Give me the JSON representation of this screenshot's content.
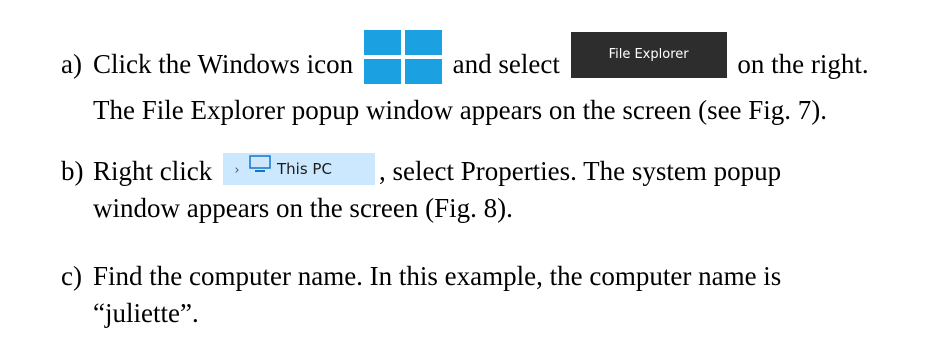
{
  "steps": [
    {
      "marker": "a)",
      "text_before_icon": "Click the Windows icon",
      "text_between": "and select",
      "text_after_button": "on the right.",
      "continuation": "The File Explorer popup window appears on the screen (see Fig. 7).",
      "icon": "windows-logo-icon",
      "button_label": "File Explorer"
    },
    {
      "marker": "b)",
      "text_before_chip": "Right click",
      "text_after_chip": ", select Properties. The system popup",
      "continuation": "window appears on the screen (Fig. 8).",
      "chip_label": "This PC",
      "chip_icons": [
        "chevron-right-icon",
        "monitor-icon"
      ]
    },
    {
      "marker": "c)",
      "text": "Find the computer name. In this example, the computer name is",
      "continuation": "“juliette”."
    }
  ],
  "colors": {
    "windows_blue": "#1ba1e2",
    "button_bg": "#2d2d2d",
    "chip_bg": "#cce8ff",
    "monitor_blue": "#0f77d1"
  }
}
